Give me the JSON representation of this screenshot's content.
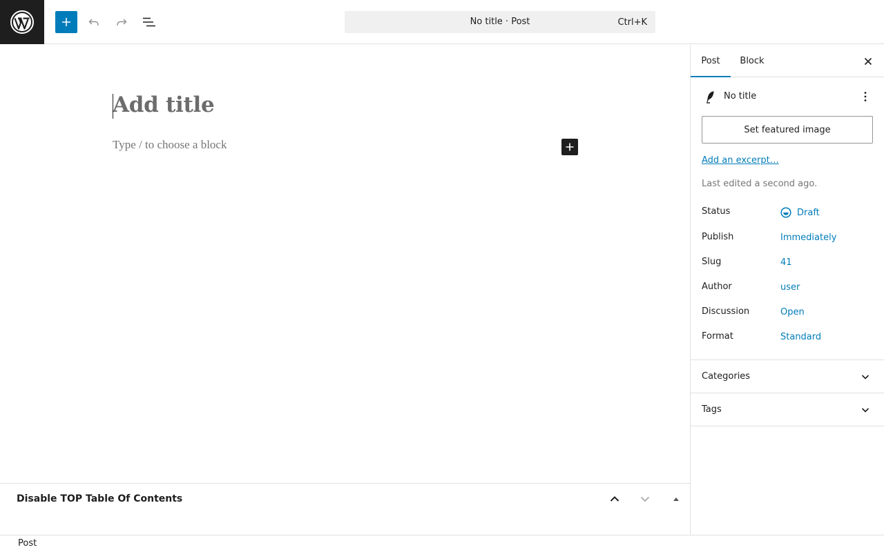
{
  "toolbar": {
    "command_title": "No title · Post",
    "command_shortcut": "Ctrl+K"
  },
  "editor": {
    "title_placeholder": "Add title",
    "block_placeholder": "Type / to choose a block"
  },
  "metabox": {
    "title": "Disable TOP Table Of Contents"
  },
  "footer": {
    "breadcrumb": "Post"
  },
  "sidebar": {
    "tabs": [
      {
        "label": "Post",
        "active": true
      },
      {
        "label": "Block",
        "active": false
      }
    ],
    "post_title": "No title",
    "featured_image_button": "Set featured image",
    "excerpt_link": "Add an excerpt…",
    "last_edited": "Last edited a second ago.",
    "rows": [
      {
        "label": "Status",
        "value": "Draft"
      },
      {
        "label": "Publish",
        "value": "Immediately"
      },
      {
        "label": "Slug",
        "value": "41"
      },
      {
        "label": "Author",
        "value": "user"
      },
      {
        "label": "Discussion",
        "value": "Open"
      },
      {
        "label": "Format",
        "value": "Standard"
      }
    ],
    "panels": [
      {
        "label": "Categories"
      },
      {
        "label": "Tags"
      }
    ]
  },
  "colors": {
    "accent": "#007cba",
    "dark": "#1e1e1e",
    "border": "#e0e0e0",
    "muted": "#757575"
  },
  "icons": [
    "wordpress-logo-icon",
    "plus-icon",
    "undo-icon",
    "redo-icon",
    "list-view-icon",
    "close-icon",
    "feather-icon",
    "more-vertical-icon",
    "draft-status-icon",
    "chevron-up-icon",
    "chevron-down-icon",
    "triangle-up-icon"
  ]
}
